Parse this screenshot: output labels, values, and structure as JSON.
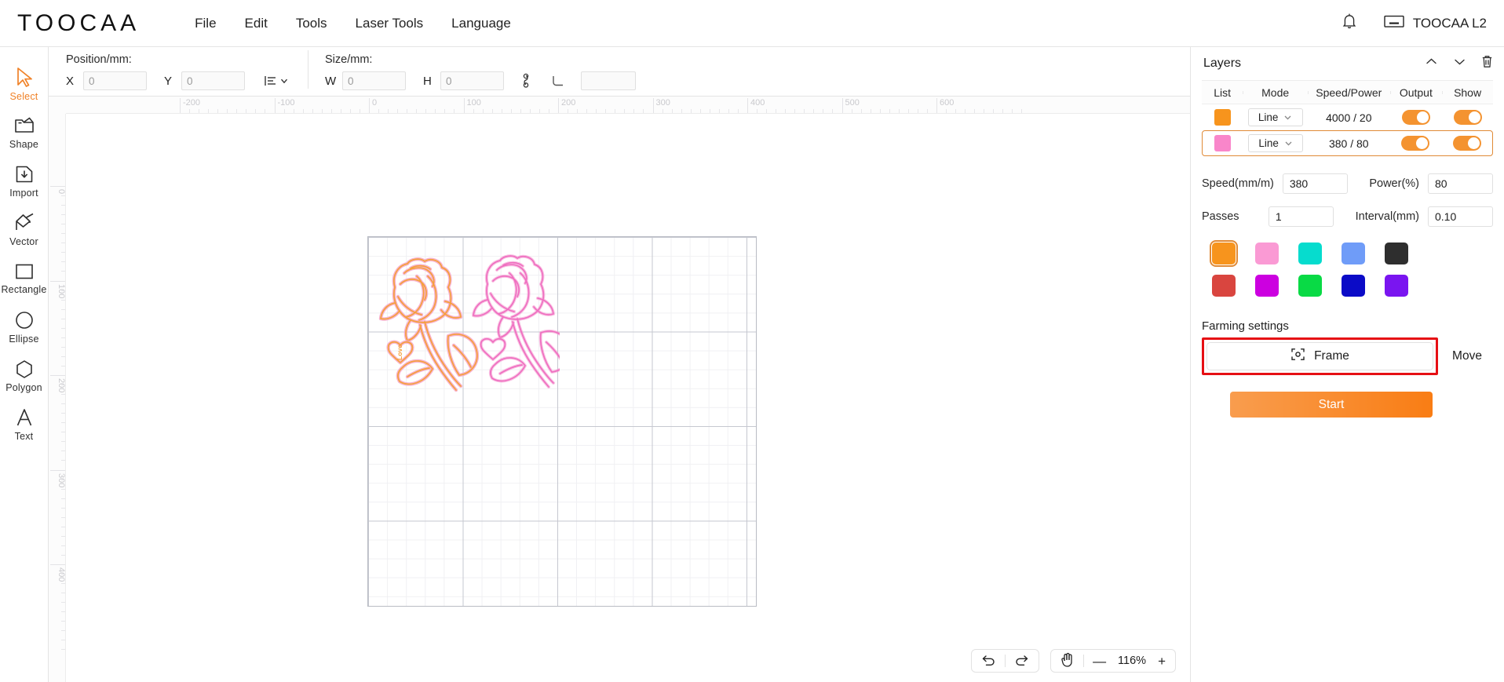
{
  "app": {
    "brand": "TOOCAA",
    "device": "TOOCAA L2"
  },
  "menu": {
    "items": [
      {
        "label": "File"
      },
      {
        "label": "Edit"
      },
      {
        "label": "Tools"
      },
      {
        "label": "Laser Tools"
      },
      {
        "label": "Language"
      }
    ]
  },
  "tools": [
    {
      "label": "Select",
      "icon": "cursor-arrow-icon",
      "active": true
    },
    {
      "label": "Shape",
      "icon": "shape-folder-icon",
      "active": false
    },
    {
      "label": "Import",
      "icon": "import-download-icon",
      "active": false
    },
    {
      "label": "Vector",
      "icon": "pen-vector-icon",
      "active": false
    },
    {
      "label": "Rectangle",
      "icon": "rectangle-icon",
      "active": false
    },
    {
      "label": "Ellipse",
      "icon": "ellipse-icon",
      "active": false
    },
    {
      "label": "Polygon",
      "icon": "polygon-icon",
      "active": false
    },
    {
      "label": "Text",
      "icon": "text-a-icon",
      "active": false
    }
  ],
  "toolbar": {
    "position_title": "Position/mm:",
    "size_title": "Size/mm:",
    "x_label": "X",
    "x_value": "0",
    "y_label": "Y",
    "y_value": "0",
    "w_label": "W",
    "w_value": "0",
    "h_label": "H",
    "h_value": "0",
    "align_icon": "align-list-dropdown-icon",
    "lock_icon": "link-chain-icon",
    "corner_icon": "corner-radius-icon",
    "corner_value": ""
  },
  "canvas": {
    "ruler_h_ticks": [
      "-200",
      "-100",
      "0",
      "100",
      "200",
      "300",
      "400",
      "500",
      "600"
    ],
    "ruler_v_ticks": [
      "0",
      "100",
      "200",
      "300",
      "400"
    ],
    "zoom_level": "116%",
    "undo_icon": "undo-arrow-icon",
    "redo_icon": "redo-arrow-icon",
    "pan_icon": "hand-pan-icon",
    "zoom_out_label": "—",
    "zoom_in_label": "+",
    "artwork": {
      "rose_left_color": "#f5a03c",
      "rose_left_glow": "#f7a8c8",
      "rose_right_color": "#f07ac4",
      "heart_text": "Love"
    }
  },
  "layers_panel": {
    "title": "Layers",
    "up_icon": "chevron-up-icon",
    "down_icon": "chevron-down-icon",
    "delete_icon": "trash-icon",
    "columns": [
      "List",
      "Mode",
      "Speed/Power",
      "Output",
      "Show"
    ],
    "rows": [
      {
        "color": "#f7941d",
        "mode": "Line",
        "speed_power": "4000 / 20",
        "output": true,
        "show": true,
        "selected": false
      },
      {
        "color": "#f986ca",
        "mode": "Line",
        "speed_power": "380 / 80",
        "output": true,
        "show": true,
        "selected": true
      }
    ]
  },
  "settings": {
    "speed_label": "Speed(mm/m)",
    "speed_value": "380",
    "power_label": "Power(%)",
    "power_value": "80",
    "passes_label": "Passes",
    "passes_value": "1",
    "interval_label": "Interval(mm)",
    "interval_value": "0.10"
  },
  "palette": {
    "row1": [
      "#f7941d",
      "#fa9ad4",
      "#06dcce",
      "#6f9cf8",
      "#2e2e2e"
    ],
    "row2": [
      "#d9453f",
      "#cc00e0",
      "#09da45",
      "#0b0bc7",
      "#7a15f0"
    ],
    "selected_index": 0
  },
  "farming": {
    "title": "Farming settings",
    "frame_label": "Frame",
    "frame_icon": "frame-target-icon",
    "move_label": "Move",
    "start_label": "Start",
    "highlight_color": "#e60f14"
  }
}
